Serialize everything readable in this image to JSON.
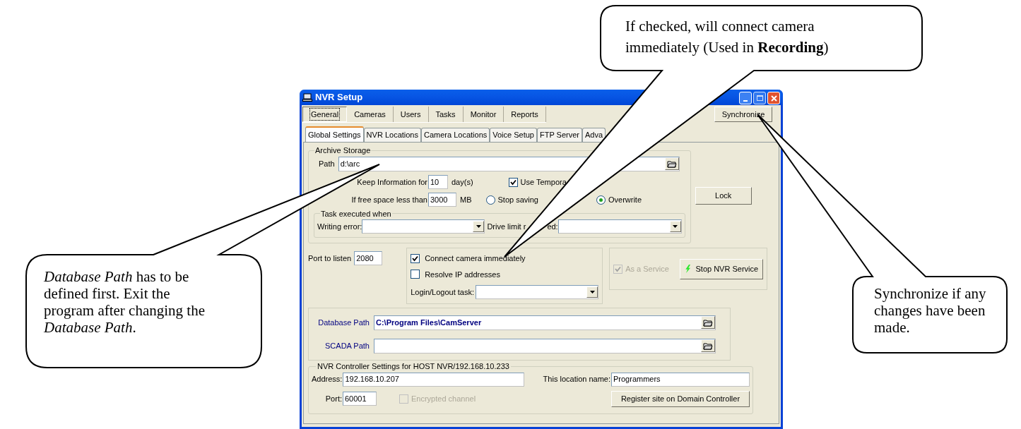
{
  "window": {
    "title": "NVR Setup",
    "tabs": [
      {
        "label": "General",
        "selected": true
      },
      {
        "label": "Cameras",
        "selected": false
      },
      {
        "label": "Users",
        "selected": false
      },
      {
        "label": "Tasks",
        "selected": false
      },
      {
        "label": "Monitor",
        "selected": false
      },
      {
        "label": "Reports",
        "selected": false
      }
    ],
    "synchronize_button": "Synchronize",
    "subtabs": [
      {
        "label": "Global Settings",
        "selected": true
      },
      {
        "label": "NVR Locations",
        "selected": false
      },
      {
        "label": "Camera Locations",
        "selected": false
      },
      {
        "label": "Voice Setup",
        "selected": false
      },
      {
        "label": "FTP Server",
        "selected": false
      },
      {
        "label": "Adva",
        "selected": false
      }
    ],
    "archive_storage": {
      "title": "Archive Storage",
      "path_label": "Path",
      "path_value": "d:\\arc",
      "keep_label": "Keep Information for",
      "keep_value": "10",
      "keep_unit": "day(s)",
      "use_temp": {
        "label": "Use Tempora",
        "checked": true
      },
      "free_label": "If free space less than",
      "free_value": "3000",
      "free_unit": "MB",
      "radios": [
        {
          "label": "Stop saving",
          "selected": false
        },
        {
          "label": "Overwrite",
          "selected": true
        }
      ],
      "task_group": {
        "title": "Task executed when",
        "writing_error_label": "Writing error:",
        "drive_limit_label": "Drive limit r",
        "drive_limit_label_end": "ed:"
      }
    },
    "lock_button": "Lock",
    "port": {
      "label": "Port to listen",
      "value": "2080"
    },
    "options": [
      {
        "label": "Connect camera immediately",
        "checked": true
      },
      {
        "label": "Resolve IP addresses",
        "checked": false
      }
    ],
    "login_task_label": "Login/Logout task:",
    "service": {
      "as_service": {
        "label": "As a Service",
        "checked": true,
        "disabled": true
      },
      "stop_button": "Stop NVR Service"
    },
    "paths": [
      {
        "label": "Database Path",
        "value": "C:\\Program Files\\CamServer"
      },
      {
        "label": "SCADA Path"
      }
    ],
    "controller": {
      "title": "NVR Controller Settings for HOST NVR/192.168.10.233",
      "address_label": "Address:",
      "address_value": "192.168.10.207",
      "location_label": "This location name:",
      "location_value": "Programmers",
      "port_label": "Port:",
      "port_value": "60001",
      "encrypted": {
        "label": "Encrypted channel",
        "checked": false,
        "disabled": true
      },
      "register_button": "Register site on Domain Controller"
    }
  },
  "callouts": [
    {
      "text": "If checked, will connect camera immediately (Used in **Recording**)"
    },
    {
      "text": "*Database Path* has to be defined first. Exit the program after changing the *Database Path*."
    },
    {
      "text": "Synchronize if any changes have been made."
    }
  ]
}
